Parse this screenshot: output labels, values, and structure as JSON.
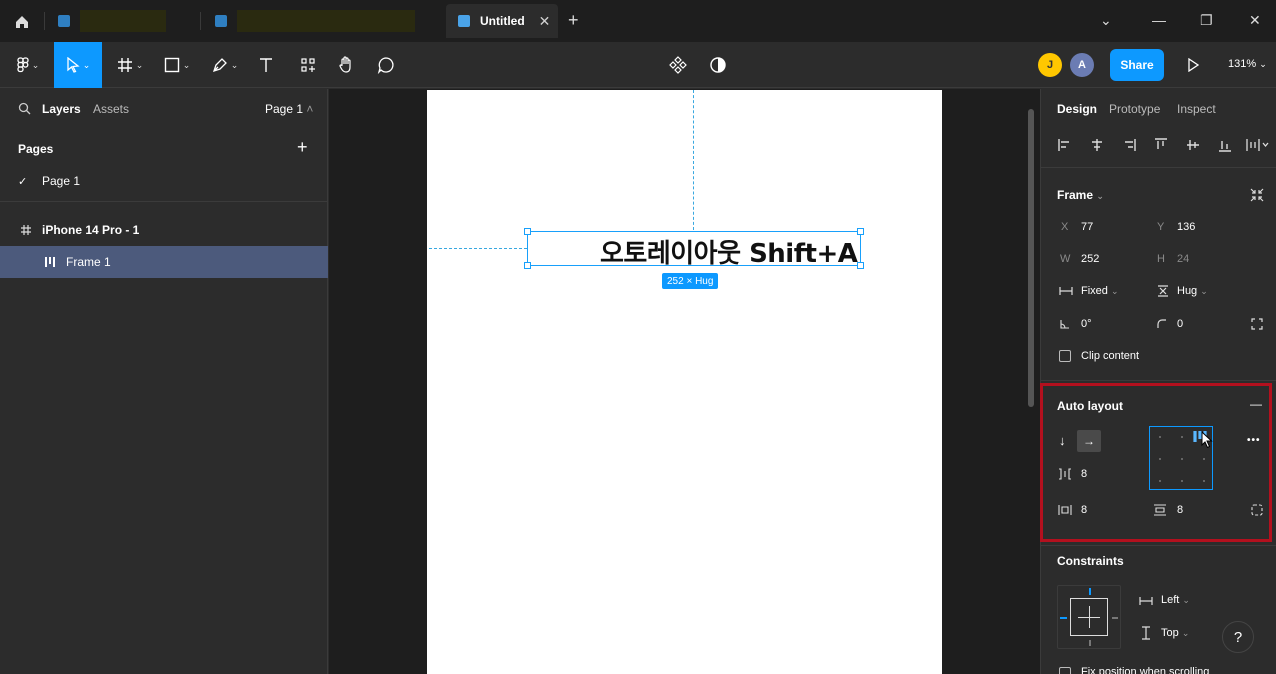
{
  "tabs": {
    "active_title": "Untitled",
    "close_glyph": "✕",
    "new_tab_glyph": "+"
  },
  "window_controls": {
    "collapse": "⌄",
    "minimize": "—",
    "restore": "❐",
    "close": "✕"
  },
  "toolbar": {
    "users": [
      "J",
      "A"
    ],
    "share_label": "Share",
    "zoom_label": "131%"
  },
  "left_panel": {
    "tab_layers": "Layers",
    "tab_assets": "Assets",
    "page_selector": "Page 1",
    "pages_heading": "Pages",
    "add_glyph": "+",
    "pages": [
      "Page 1"
    ],
    "layers": [
      {
        "name": "iPhone 14 Pro - 1",
        "icon": "frame-hash-icon"
      },
      {
        "name": "Frame 1",
        "icon": "auto-layout-icon",
        "selected": true
      }
    ]
  },
  "canvas": {
    "selected_text": "오토레이아웃 Shift+A",
    "size_badge": "252 × Hug"
  },
  "right_panel": {
    "tabs": [
      "Design",
      "Prototype",
      "Inspect"
    ],
    "frame_section": {
      "title": "Frame",
      "x_label": "X",
      "x_value": "77",
      "y_label": "Y",
      "y_value": "136",
      "w_label": "W",
      "w_value": "252",
      "h_label": "H",
      "h_value": "24",
      "width_mode": "Fixed",
      "height_mode": "Hug",
      "rotation": "0°",
      "corner_radius": "0",
      "clip_content_label": "Clip content"
    },
    "auto_layout": {
      "title": "Auto layout",
      "remove_glyph": "—",
      "more_glyph": "•••",
      "spacing": "8",
      "padding_h": "8",
      "padding_v": "8"
    },
    "constraints": {
      "title": "Constraints",
      "horizontal": "Left",
      "vertical": "Top",
      "fix_position_label": "Fix position when scrolling"
    },
    "help_glyph": "?"
  }
}
